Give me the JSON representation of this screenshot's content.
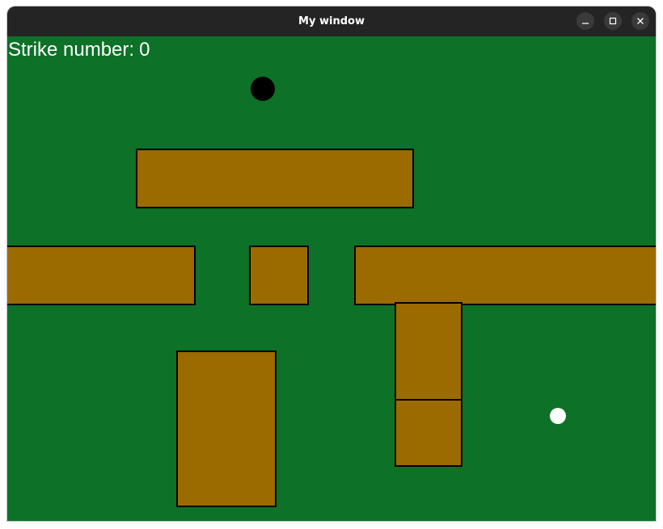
{
  "window": {
    "title": "My window"
  },
  "hud": {
    "strike_label": "Strike number:",
    "strike_count": "0"
  },
  "colors": {
    "field": "#0d7128",
    "wall": "#9b6b00",
    "wall_border": "#000000",
    "hole": "#000000",
    "ball": "#ffffff",
    "titlebar": "#242424"
  },
  "icons": {
    "minimize": "minimize-icon",
    "maximize": "maximize-icon",
    "close": "close-icon"
  }
}
